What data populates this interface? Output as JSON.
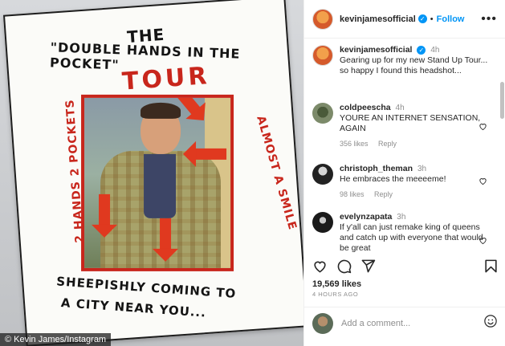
{
  "photo": {
    "poster_line1": "THE",
    "poster_line2": "\"DOUBLE HANDS IN THE POCKET\"",
    "poster_line3": "TOUR",
    "poster_left": "2 HANDS 2 POCKETS",
    "poster_right": "ALMOST A SMILE",
    "poster_bottom1": "SHEEPISHLY COMING TO",
    "poster_bottom2": "A CITY NEAR YOU...",
    "credit": "© Kevin James/Instagram"
  },
  "header": {
    "username": "kevinjamesofficial",
    "separator": "•",
    "follow_label": "Follow",
    "more_icon": "more-horizontal-icon"
  },
  "caption": {
    "username": "kevinjamesofficial",
    "time": "4h",
    "text": "Gearing up for my new Stand Up Tour... so happy I found this headshot..."
  },
  "comments": [
    {
      "username": "coldpeescha",
      "time": "4h",
      "text": "YOURE AN INTERNET SENSATION, AGAIN",
      "likes": "356 likes",
      "reply": "Reply"
    },
    {
      "username": "christoph_theman",
      "time": "3h",
      "text": "He embraces the meeeeme!",
      "likes": "98 likes",
      "reply": "Reply"
    },
    {
      "username": "evelynzapata",
      "time": "3h",
      "text": "If y'all can just remake king of queens and catch up with everyone that would be great",
      "likes": "",
      "reply": ""
    }
  ],
  "actions": {
    "like_icon": "heart-icon",
    "comment_icon": "comment-icon",
    "share_icon": "share-icon",
    "save_icon": "bookmark-icon"
  },
  "likes_count": "19,569 likes",
  "post_time": "4 HOURS AGO",
  "add_comment": {
    "placeholder": "Add a comment...",
    "emoji_icon": "emoji-icon"
  },
  "colors": {
    "accent": "#0095f6",
    "poster_red": "#c8261c",
    "arrow_red": "#e0391f"
  }
}
